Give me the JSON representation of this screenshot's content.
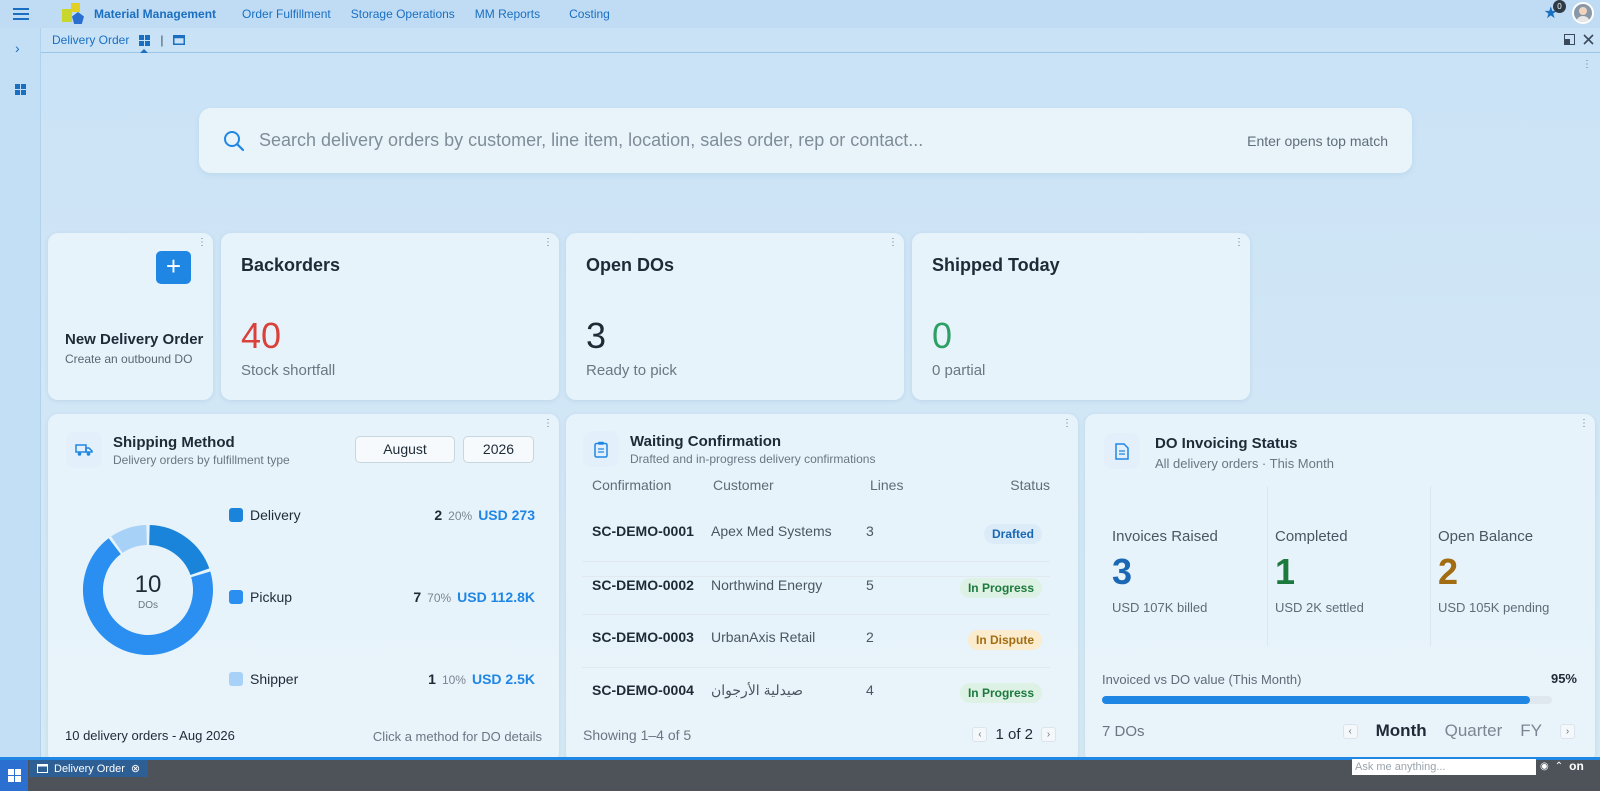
{
  "app": {
    "name": "Material Management",
    "nav": [
      "Order Fulfillment",
      "Storage Operations",
      "MM Reports",
      "Costing"
    ],
    "notification_count": "0"
  },
  "tabbar": {
    "title": "Delivery Order",
    "separator": "|"
  },
  "search": {
    "placeholder": "Search delivery orders by customer, line item, location, sales order, rep or contact...",
    "hint": "Enter opens top match"
  },
  "new_do": {
    "plus": "+",
    "title": "New Delivery Order",
    "subtitle": "Create an outbound DO"
  },
  "kpis": [
    {
      "title": "Backorders",
      "value": "40",
      "subtitle": "Stock shortfall",
      "color": "#d9413b"
    },
    {
      "title": "Open DOs",
      "value": "3",
      "subtitle": "Ready to pick",
      "color": "#1e2a36"
    },
    {
      "title": "Shipped Today",
      "value": "0",
      "subtitle": "0 partial",
      "color": "#2ea065"
    }
  ],
  "shipping": {
    "title": "Shipping Method",
    "subtitle": "Delivery orders by fulfillment type",
    "month": "August",
    "year": "2026",
    "total": "10",
    "total_label": "DOs",
    "methods": [
      {
        "name": "Delivery",
        "count": "2",
        "pct": "20%",
        "amount": "USD 273",
        "color": "#1a84db",
        "share": 0.2
      },
      {
        "name": "Pickup",
        "count": "7",
        "pct": "70%",
        "amount": "USD 112.8K",
        "color": "#2a8ff0",
        "share": 0.7
      },
      {
        "name": "Shipper",
        "count": "1",
        "pct": "10%",
        "amount": "USD 2.5K",
        "color": "#a8d1f7",
        "share": 0.1
      }
    ],
    "footer_left": "10 delivery orders - Aug 2026",
    "footer_right": "Click a method for DO details"
  },
  "waiting": {
    "title": "Waiting Confirmation",
    "subtitle": "Drafted and in-progress delivery confirmations",
    "headers": {
      "confirmation": "Confirmation",
      "customer": "Customer",
      "lines": "Lines",
      "status": "Status"
    },
    "rows": [
      {
        "id": "SC-DEMO-0001",
        "customer": "Apex Med Systems",
        "lines": "3",
        "status": "Drafted"
      },
      {
        "id": "SC-DEMO-0002",
        "customer": "Northwind Energy",
        "lines": "5",
        "status": "In Progress"
      },
      {
        "id": "SC-DEMO-0003",
        "customer": "UrbanAxis Retail",
        "lines": "2",
        "status": "In Dispute"
      },
      {
        "id": "SC-DEMO-0004",
        "customer": "صيدلية الأرجوان",
        "lines": "4",
        "status": "In Progress"
      }
    ],
    "showing": "Showing 1–4 of 5",
    "page": "1 of 2"
  },
  "invoicing": {
    "title": "DO Invoicing Status",
    "subtitle": "All delivery orders · This Month",
    "stats": [
      {
        "label": "Invoices Raised",
        "value": "3",
        "sub": "USD 107K billed",
        "color": "#1a68b4"
      },
      {
        "label": "Completed",
        "value": "1",
        "sub": "USD 2K settled",
        "color": "#1c7a3e"
      },
      {
        "label": "Open Balance",
        "value": "2",
        "sub": "USD 105K pending",
        "color": "#a26d12"
      }
    ],
    "bar_label": "Invoiced vs DO value (This Month)",
    "bar_pct": "95%",
    "bar_value": 0.95,
    "count": "7 DOs",
    "periods": [
      "Month",
      "Quarter",
      "FY"
    ],
    "active_period": "Month"
  },
  "taskbar": {
    "item": "Delivery Order",
    "ask_placeholder": "Ask me anything...",
    "clock_icon": "on"
  }
}
